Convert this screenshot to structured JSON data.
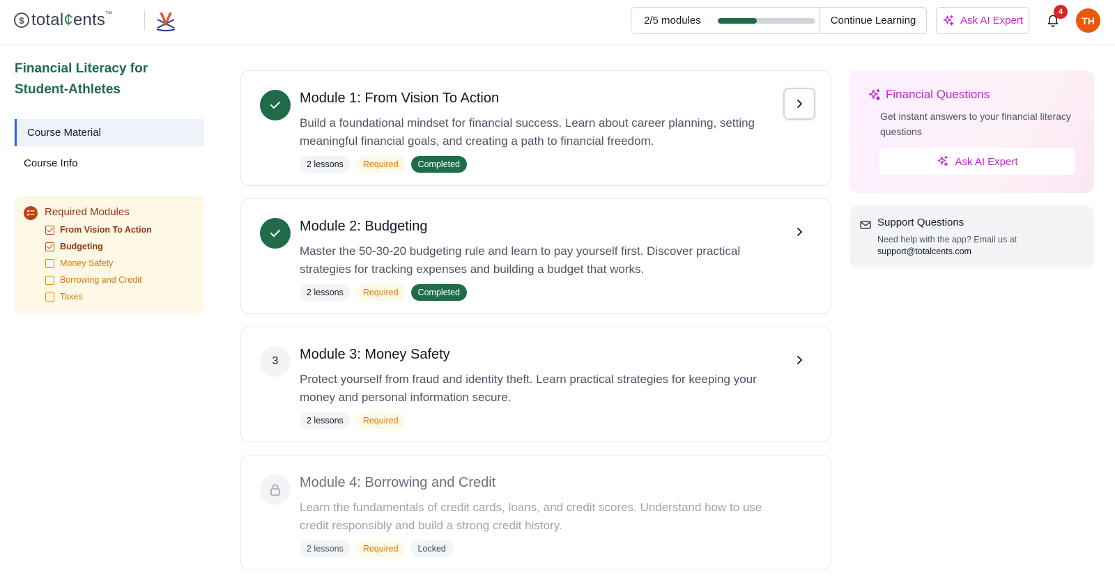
{
  "header": {
    "logo_text_pre": "total",
    "logo_text_cents": "¢",
    "logo_text_post": "ents",
    "logo_tm": "™",
    "logo_dollar": "$",
    "progress_label": "2/5 modules",
    "progress_fraction": 0.4,
    "continue_label": "Continue Learning",
    "ask_expert_label": "Ask AI Expert",
    "notification_count": "4",
    "avatar_initials": "TH"
  },
  "sidebar": {
    "course_title": "Financial Literacy for Student-Athletes",
    "nav": [
      {
        "label": "Course Material",
        "active": true
      },
      {
        "label": "Course Info",
        "active": false
      }
    ],
    "required": {
      "title": "Required Modules",
      "items": [
        {
          "label": "From Vision To Action",
          "done": true
        },
        {
          "label": "Budgeting",
          "done": true
        },
        {
          "label": "Money Safety",
          "done": false
        },
        {
          "label": "Borrowing and Credit",
          "done": false
        },
        {
          "label": "Taxes",
          "done": false
        }
      ]
    }
  },
  "modules": [
    {
      "title": "Module 1: From Vision To Action",
      "description": "Build a foundational mindset for financial success. Learn about career planning, setting meaningful financial goals, and creating a path to financial freedom.",
      "lessons": "2 lessons",
      "required": "Required",
      "status": "Completed",
      "icon": "check-icon"
    },
    {
      "title": "Module 2: Budgeting",
      "description": "Master the 50-30-20 budgeting rule and learn to pay yourself first. Discover practical strategies for tracking expenses and building a budget that works.",
      "lessons": "2 lessons",
      "required": "Required",
      "status": "Completed",
      "icon": "check-icon"
    },
    {
      "title": "Module 3: Money Safety",
      "description": "Protect yourself from fraud and identity theft. Learn practical strategies for keeping your money and personal information secure.",
      "lessons": "2 lessons",
      "required": "Required",
      "number": "3"
    },
    {
      "title": "Module 4: Borrowing and Credit",
      "description": "Learn the fundamentals of credit cards, loans, and credit scores. Understand how to use credit responsibly and build a strong credit history.",
      "lessons": "2 lessons",
      "required": "Required",
      "status": "Locked",
      "icon": "lock-icon"
    }
  ],
  "right_panel": {
    "financial": {
      "title": "Financial Questions",
      "description": "Get instant answers to your financial literacy questions",
      "button_label": "Ask AI Expert"
    },
    "support": {
      "title": "Support Questions",
      "description": "Need help with the app? Email us at",
      "email": "support@totalcents.com"
    }
  },
  "colors": {
    "brand_green": "#1f6b4a",
    "accent_magenta": "#c026d3",
    "required_orange": "#d97706",
    "badge_red": "#dc2626",
    "avatar_orange": "#ea580c"
  }
}
